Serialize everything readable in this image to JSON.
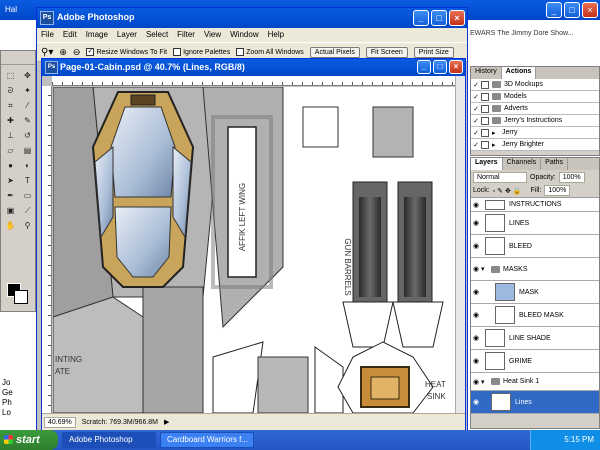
{
  "browser": {
    "tab_label": "Hal",
    "links_text": "EWARS   The Jimmy Dore Show...",
    "side_text": [
      "Jo",
      "Ge",
      "Ph",
      "Lo"
    ]
  },
  "photoshop": {
    "title": "Adobe Photoshop",
    "menu": [
      "File",
      "Edit",
      "Image",
      "Layer",
      "Select",
      "Filter",
      "View",
      "Window",
      "Help"
    ],
    "options": {
      "resize_windows": "Resize Windows To Fit",
      "ignore_palettes": "Ignore Palettes",
      "zoom_all": "Zoom All Windows",
      "actual_pixels": "Actual Pixels",
      "fit_screen": "Fit Screen",
      "print_size": "Print Size"
    }
  },
  "document": {
    "title": "Page-01-Cabin.psd @ 40.7% (Lines, RGB/8)",
    "zoom": "40.69%",
    "scratch": "Scratch: 769.3M/966.8M",
    "canvas_labels": {
      "left_wing": "AFFIK LEFT WING",
      "gun_barrels": "GUN BARRELS",
      "jointing": "INTING",
      "plate": "ATE",
      "heat": "HEAT",
      "sink": "SINK"
    }
  },
  "actions": {
    "tabs": [
      "History",
      "Actions"
    ],
    "items": [
      "3D Mockups",
      "Models",
      "Adverts",
      "Jerry's Instructions",
      "Jerry",
      "Jerry Brighter"
    ]
  },
  "layers": {
    "tabs": [
      "Layers",
      "Channels",
      "Paths"
    ],
    "blend_mode": "Normal",
    "opacity_label": "Opacity:",
    "opacity": "100%",
    "lock_label": "Lock:",
    "fill_label": "Fill:",
    "fill": "100%",
    "items": [
      {
        "name": "INSTRUCTIONS",
        "type": "layer"
      },
      {
        "name": "LINES",
        "type": "layer"
      },
      {
        "name": "BLEED",
        "type": "layer"
      },
      {
        "name": "MASKS",
        "type": "group"
      },
      {
        "name": "MASK",
        "type": "layer"
      },
      {
        "name": "BLEED MASK",
        "type": "layer"
      },
      {
        "name": "LINE SHADE",
        "type": "layer"
      },
      {
        "name": "GRIME",
        "type": "layer"
      },
      {
        "name": "Heat Sink 1",
        "type": "group"
      },
      {
        "name": "Lines",
        "type": "layer",
        "selected": true
      }
    ]
  },
  "taskbar": {
    "start": "start",
    "items": [
      "Adobe Photoshop",
      "Cardboard Warriors f..."
    ],
    "clock": "5:15 PM"
  }
}
